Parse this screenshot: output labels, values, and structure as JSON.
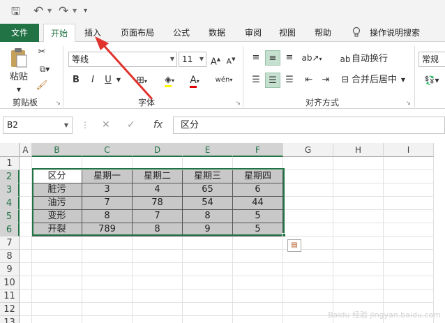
{
  "quick_access": {
    "save_icon": "save-icon",
    "undo_icon": "undo-icon",
    "redo_icon": "redo-icon"
  },
  "tabs": [
    "文件",
    "开始",
    "插入",
    "页面布局",
    "公式",
    "数据",
    "审阅",
    "视图",
    "帮助"
  ],
  "tell_me": "操作说明搜索",
  "ribbon": {
    "paste_label": "粘贴",
    "clipboard_group": "剪贴板",
    "font_name": "等线",
    "font_size": "11",
    "bold": "B",
    "italic": "I",
    "underline": "U",
    "font_group": "字体",
    "wrap_text": "自动换行",
    "merge_center": "合并后居中",
    "alignment_group": "对齐方式",
    "number_format": "常规"
  },
  "formula_bar": {
    "name_box": "B2",
    "fx": "fx",
    "formula": "区分"
  },
  "grid": {
    "columns": [
      "A",
      "B",
      "C",
      "D",
      "E",
      "F",
      "G",
      "H",
      "I"
    ],
    "rows": [
      "1",
      "2",
      "3",
      "4",
      "5",
      "6",
      "7",
      "8",
      "9",
      "10",
      "11",
      "12",
      "13"
    ],
    "table": [
      [
        "区分",
        "星期一",
        "星期二",
        "星期三",
        "星期四"
      ],
      [
        "脏污",
        "3",
        "4",
        "65",
        "6"
      ],
      [
        "油污",
        "7",
        "78",
        "54",
        "44"
      ],
      [
        "变形",
        "8",
        "7",
        "8",
        "5"
      ],
      [
        "开裂",
        "789",
        "8",
        "9",
        "5"
      ]
    ]
  },
  "watermark": "Baidu 经验 jingyan.baidu.com",
  "colors": {
    "excel_green": "#217346",
    "selection_fill": "#c8c8c8",
    "annotation_red": "#e0332e"
  }
}
